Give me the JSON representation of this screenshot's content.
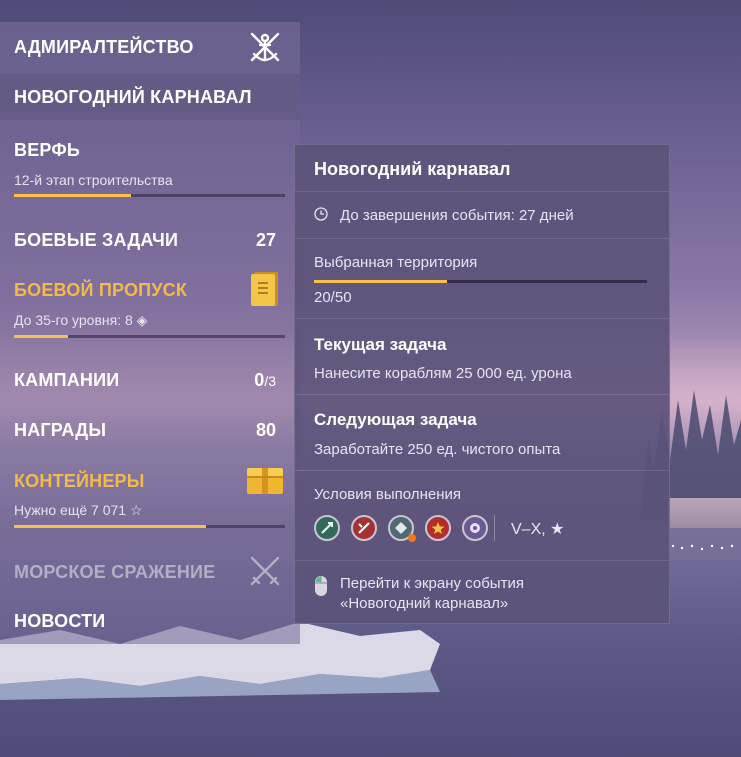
{
  "sidebar": {
    "items": [
      {
        "label": "АДМИРАЛТЕЙСТВО",
        "icon": "admiralty-anchor-icon"
      },
      {
        "label": "НОВОГОДНИЙ КАРНАВАЛ"
      },
      {
        "label": "ВЕРФЬ",
        "sub": "12-й этап строительства",
        "progress": 0.43
      },
      {
        "label": "БОЕВЫЕ ЗАДАЧИ",
        "count": "27"
      },
      {
        "label": "БОЕВОЙ ПРОПУСК",
        "sub_prefix": "До 35-го уровня:",
        "sub_value": "8",
        "sub_icon": "diamond-icon",
        "progress": 0.2,
        "icon": "battle-pass-booklet-icon"
      },
      {
        "label": "КАМПАНИИ",
        "count_main": "0",
        "count_rest": "/3"
      },
      {
        "label": "НАГРАДЫ",
        "count": "80"
      },
      {
        "label": "КОНТЕЙНЕРЫ",
        "sub_prefix": "Нужно ещё",
        "sub_value": "7 071",
        "sub_icon": "star-icon",
        "progress": 0.71,
        "icon": "container-chest-icon"
      },
      {
        "label": "МОРСКОЕ СРАЖЕНИЕ",
        "icon": "crossed-swords-icon",
        "disabled": true
      },
      {
        "label": "НОВОСТИ"
      }
    ]
  },
  "popup": {
    "title": "Новогодний карнавал",
    "time_label": "До завершения события: 27 дней",
    "territory_label": "Выбранная территория",
    "territory_value": "20/50",
    "territory_progress": 0.4,
    "current_title": "Текущая задача",
    "current_text": "Нанесите кораблям 25 000 ед. урона",
    "next_title": "Следующая задача",
    "next_text": "Заработайте 250 ед. чистого опыта",
    "conditions_title": "Условия выполнения",
    "ship_classes": [
      "submarine-class-icon",
      "destroyer-class-icon",
      "cruiser-class-icon",
      "battleship-class-icon",
      "aircraft-carrier-class-icon"
    ],
    "tiers": "V–X, ★",
    "goto_line1": "Перейти к экрану события",
    "goto_line2": "«Новогодний карнавал»"
  },
  "colors": {
    "accent": "#f3b94a",
    "progress": "#f6c146",
    "popup_bg": "#5c527a"
  }
}
